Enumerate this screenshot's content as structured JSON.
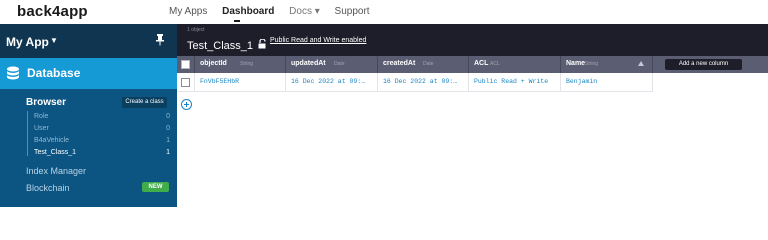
{
  "brand": {
    "logo": "back4app"
  },
  "nav": {
    "my_apps": "My Apps",
    "dashboard": "Dashboard",
    "docs": "Docs ▾",
    "support": "Support"
  },
  "sidebar": {
    "app_name": "My App",
    "database_label": "Database",
    "browser_label": "Browser",
    "create_class_label": "Create a class",
    "classes": [
      {
        "name": "Role",
        "count": "0"
      },
      {
        "name": "User",
        "count": "0"
      },
      {
        "name": "B4aVehicle",
        "count": "1"
      },
      {
        "name": "Test_Class_1",
        "count": "1",
        "active": true
      }
    ],
    "index_manager_label": "Index Manager",
    "blockchain_label": "Blockchain",
    "new_badge": "NEW"
  },
  "header": {
    "object_count": "1 object",
    "class_name": "Test_Class_1",
    "permissions_link": "Public Read and Write enabled"
  },
  "table": {
    "columns": [
      {
        "name": "objectId",
        "type": "String"
      },
      {
        "name": "updatedAt",
        "type": "Date"
      },
      {
        "name": "createdAt",
        "type": "Date"
      },
      {
        "name": "ACL",
        "type": "ACL"
      },
      {
        "name": "Name",
        "type": "String"
      }
    ],
    "add_column_label": "Add a new column",
    "rows": [
      [
        "FnVbF5EHbR",
        "16 Dec 2022 at 09:…",
        "16 Dec 2022 at 09:…",
        "Public Read + Write",
        "Benjamin"
      ]
    ]
  },
  "colors": {
    "sidebar_bg": "#0c5582",
    "sidebar_active": "#169ad6",
    "header_bg": "#1d1e2a",
    "column_header_bg": "#5b5d72",
    "link_blue": "#1a85c4",
    "new_badge": "#41ad4a"
  }
}
